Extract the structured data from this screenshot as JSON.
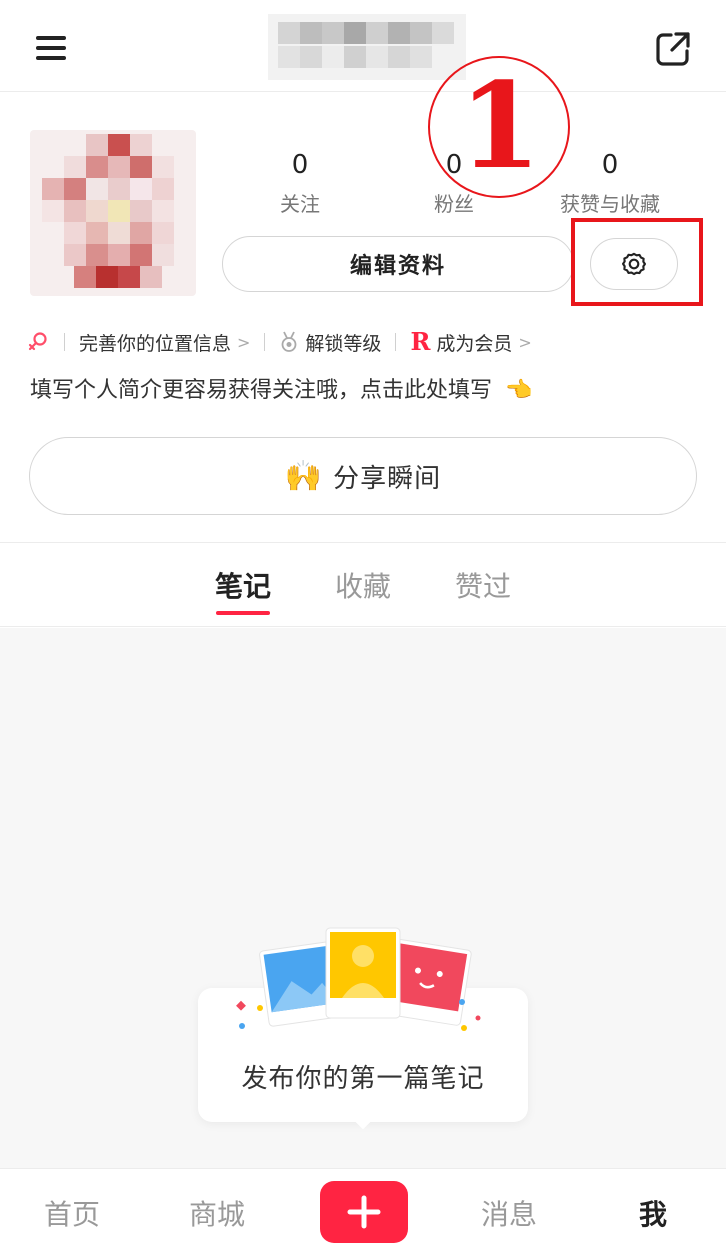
{
  "header": {
    "menu_icon": "hamburger-menu-icon",
    "share_icon": "share-external-icon",
    "title_obscured": true
  },
  "profile": {
    "avatar_obscured": true,
    "stats": [
      {
        "value": "0",
        "label": "关注"
      },
      {
        "value": "0",
        "label": "粉丝"
      },
      {
        "value": "0",
        "label": "获赞与收藏"
      }
    ],
    "edit_label": "编辑资料",
    "settings_icon": "gear-icon"
  },
  "annotation": {
    "number": "1",
    "color": "#e8161b"
  },
  "tags": [
    {
      "icon": "gender-female-icon",
      "label": ""
    },
    {
      "icon": "location-icon",
      "label": "完善你的位置信息"
    },
    {
      "icon": "medal-icon",
      "label": "解锁等级"
    },
    {
      "icon": "member-r-icon",
      "label": "成为会员"
    }
  ],
  "bio": {
    "text": "填写个人简介更容易获得关注哦，点击此处填写",
    "emoji": "👈"
  },
  "share_moment": {
    "emoji": "🙌",
    "label": "分享瞬间"
  },
  "tabs": {
    "items": [
      "笔记",
      "收藏",
      "赞过"
    ],
    "active": "笔记",
    "accent": "#ff2442"
  },
  "empty_state": {
    "text": "发布你的第一篇笔记"
  },
  "bottom_nav": {
    "items": [
      "首页",
      "商城",
      "消息",
      "我"
    ],
    "active": "我",
    "publish_icon": "plus-icon",
    "publish_color": "#ff2442"
  }
}
